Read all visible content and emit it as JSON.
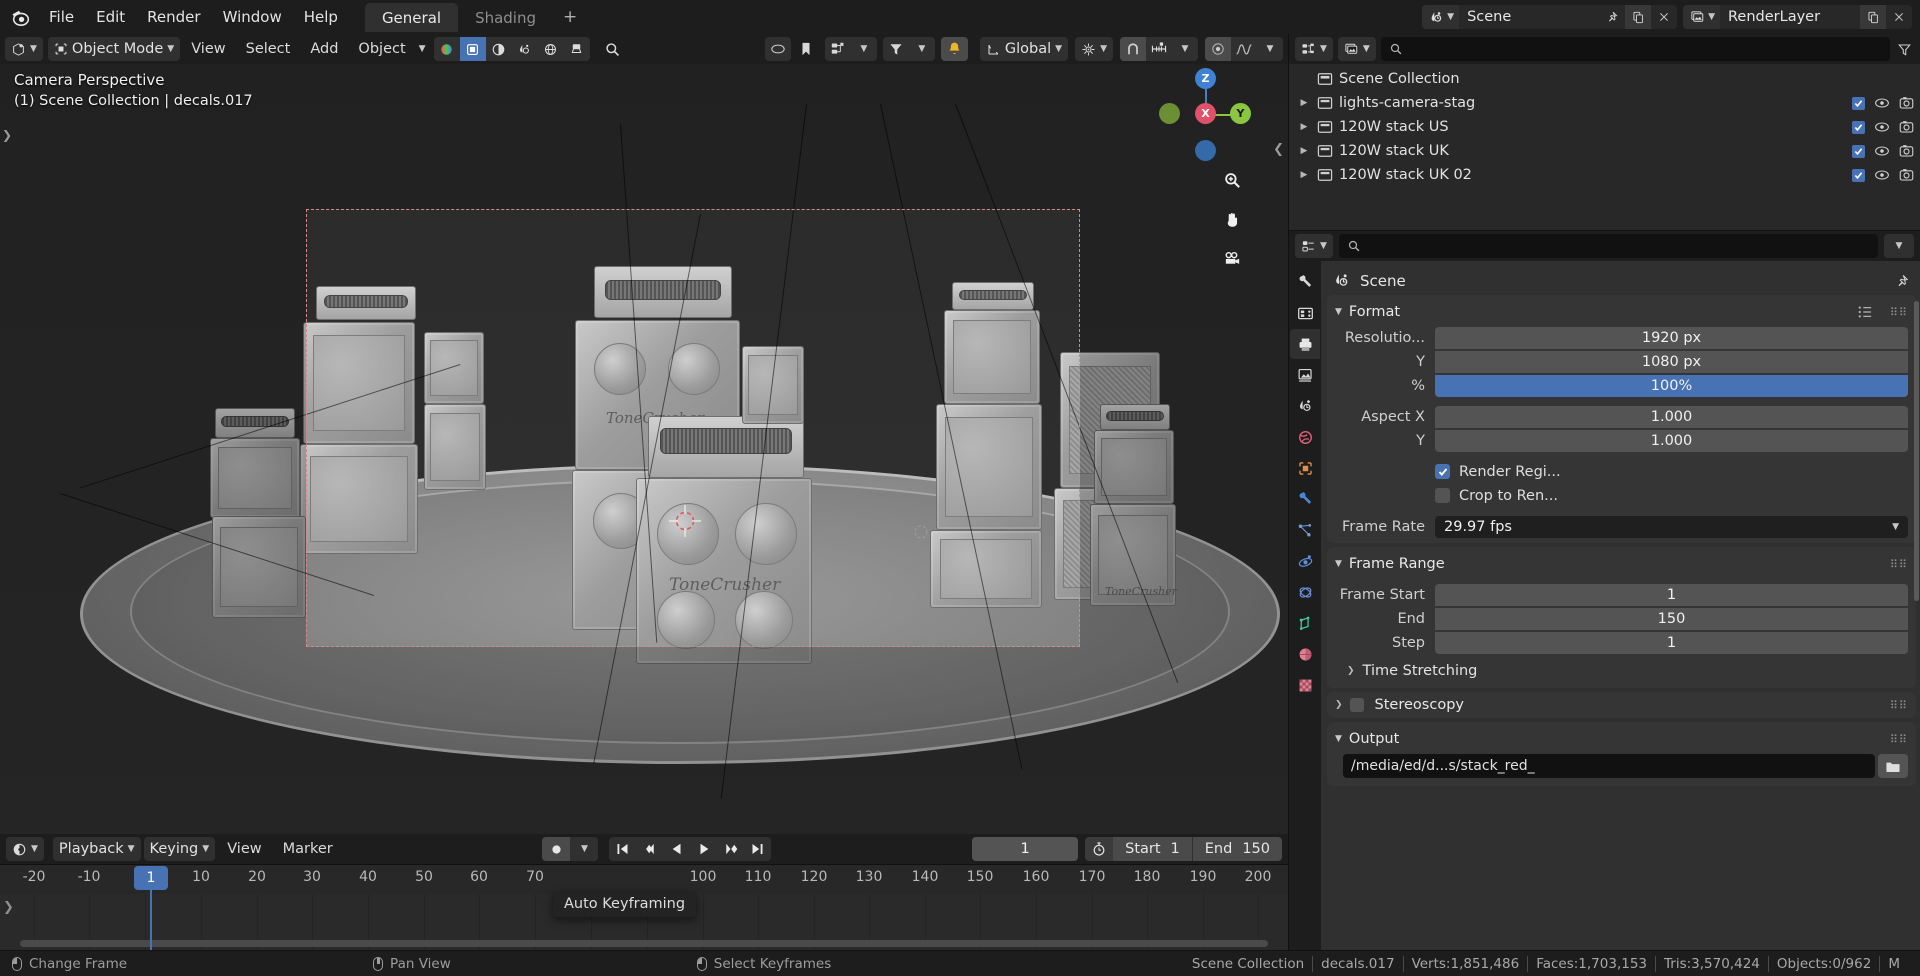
{
  "topbar": {
    "logo_icon": "blender-logo-icon",
    "menus": [
      "File",
      "Edit",
      "Render",
      "Window",
      "Help"
    ],
    "workspace_tabs": [
      {
        "label": "General",
        "active": true
      },
      {
        "label": "Shading",
        "active": false
      }
    ],
    "add_workspace_label": "+",
    "scene_block": {
      "icon": "scene-icon",
      "name": "Scene",
      "pin_icon": "pin-icon",
      "new_icon": "duplicate-icon",
      "close_icon": "x-icon"
    },
    "viewlayer_block": {
      "icon": "render-layers-icon",
      "name": "RenderLayer",
      "new_icon": "duplicate-icon",
      "close_icon": "x-icon"
    }
  },
  "viewport_header": {
    "editor_type_icon": "editor-type-3dview-icon",
    "mode_icon": "object-mode-icon",
    "mode_label": "Object Mode",
    "menus": [
      "View",
      "Select",
      "Add",
      "Object"
    ],
    "object_dropdown_chevron": "chevron-down-icon",
    "shading_modes": [
      "wireframe-icon",
      "solid-icon",
      "material-preview-icon",
      "rendered-icon"
    ],
    "overlay_icons": [
      "gizmo-icon",
      "overlays-icon",
      "xray-icon",
      "shading-globe-icon",
      "shading-brush-icon"
    ],
    "search_icon": "search-icon",
    "right_icons": [
      "visibility-icon",
      "marker-icon",
      "collection-visibility-icon",
      "filter-icon",
      "notification-bell-icon"
    ],
    "transform_orientation": {
      "icon": "orientation-icon",
      "label": "Global",
      "chevron": "chevron-down-icon"
    },
    "pivot_icon": "pivot-point-icon",
    "snap_magnet_icon": "snap-magnet-icon",
    "snap_to_icon": "snap-increment-icon",
    "proportional_icon": "proportional-edit-icon",
    "falloff_icon": "proportional-falloff-icon"
  },
  "viewport": {
    "line1": "Camera Perspective",
    "line2": "(1) Scene Collection | decals.017",
    "gizmo": {
      "z": "Z",
      "x": "X",
      "y": "Y"
    },
    "nav_buttons": [
      "zoom-icon",
      "pan-hand-icon",
      "camera-view-icon"
    ],
    "collapse_icon": "chevron-left-icon",
    "amp_logo_text": "ToneCrusher"
  },
  "timeline": {
    "editor_icon": "timeline-editor-icon",
    "menus": [
      "Playback",
      "Keying",
      "View",
      "Marker"
    ],
    "record_icon": "record-keying-icon",
    "transport": [
      "jump-start-icon",
      "prev-keyframe-icon",
      "play-reverse-icon",
      "play-icon",
      "next-keyframe-icon",
      "jump-end-icon"
    ],
    "current_frame": "1",
    "stopwatch_icon": "use-preview-range-icon",
    "start_label": "Start",
    "start_value": "1",
    "end_label": "End",
    "end_value": "150",
    "ticks": [
      "-20",
      "-10",
      "1",
      "10",
      "20",
      "30",
      "40",
      "50",
      "60",
      "70",
      "100",
      "110",
      "120",
      "130",
      "140",
      "150",
      "160",
      "170",
      "180",
      "190",
      "200"
    ],
    "playhead_label": "1",
    "tooltip": "Auto Keyframing",
    "side_arrow_icon": "chevron-right-icon"
  },
  "outliner": {
    "display_mode_icon": "outliner-display-mode-icon",
    "filter_id_icon": "outliner-id-filter-icon",
    "search_icon": "search-icon",
    "filter_icon": "filter-icon",
    "root": {
      "icon": "scene-collection-icon",
      "label": "Scene Collection"
    },
    "rows": [
      {
        "label": "lights-camera-stag",
        "icon": "collection-icon",
        "expand": "triangle-right-icon",
        "checkbox": true,
        "eye_icon": "eye-icon",
        "camera_icon": "camera-render-icon"
      },
      {
        "label": "120W stack US",
        "icon": "collection-icon",
        "expand": "triangle-right-icon",
        "checkbox": true,
        "eye_icon": "eye-icon",
        "camera_icon": "camera-render-icon"
      },
      {
        "label": "120W stack UK",
        "icon": "collection-icon",
        "expand": "triangle-right-icon",
        "checkbox": true,
        "eye_icon": "eye-icon",
        "camera_icon": "camera-render-icon"
      },
      {
        "label": "120W stack UK 02",
        "icon": "collection-icon",
        "expand": "triangle-right-icon",
        "checkbox": true,
        "eye_icon": "eye-icon",
        "camera_icon": "camera-render-icon"
      }
    ]
  },
  "properties": {
    "editor_icon": "properties-editor-icon",
    "search_icon": "search-icon",
    "options_chevron": "chevron-down-icon",
    "id_icon": "scene-properties-icon",
    "id_name": "Scene",
    "pin_icon": "pin-icon",
    "tabs": [
      {
        "name": "tool-tab",
        "icon": "wrench-screwdriver-icon",
        "active": false
      },
      {
        "name": "render-tab",
        "icon": "camera-back-icon",
        "active": false
      },
      {
        "name": "output-tab",
        "icon": "printer-icon",
        "active": true
      },
      {
        "name": "view-layer-tab",
        "icon": "images-icon",
        "active": false
      },
      {
        "name": "scene-tab",
        "icon": "scene-cone-icon",
        "active": false
      },
      {
        "name": "world-tab",
        "icon": "world-globe-icon",
        "active": false
      },
      {
        "name": "object-tab",
        "icon": "object-square-icon",
        "active": false
      },
      {
        "name": "modifier-tab",
        "icon": "wrench-icon",
        "active": false
      },
      {
        "name": "particles-tab",
        "icon": "particles-icon",
        "active": false
      },
      {
        "name": "physics-tab",
        "icon": "physics-orbit-icon",
        "active": false
      },
      {
        "name": "constraints-tab",
        "icon": "constraint-icon",
        "active": false
      },
      {
        "name": "data-tab",
        "icon": "mesh-data-icon",
        "active": false
      },
      {
        "name": "material-tab",
        "icon": "material-sphere-icon",
        "active": false
      },
      {
        "name": "texture-tab",
        "icon": "texture-checker-icon",
        "active": false
      }
    ],
    "format_panel": {
      "title": "Format",
      "preset_icon": "preset-list-icon",
      "grip_icon": "grip-dots-icon",
      "rows": [
        {
          "label": "Resolutio...",
          "value": "1920 px",
          "highlight": false
        },
        {
          "label": "Y",
          "value": "1080 px",
          "highlight": false
        },
        {
          "label": "%",
          "value": "100%",
          "highlight": true
        }
      ],
      "aspect": [
        {
          "label": "Aspect X",
          "value": "1.000"
        },
        {
          "label": "Y",
          "value": "1.000"
        }
      ],
      "checks": [
        {
          "label": "Render Regi...",
          "checked": true
        },
        {
          "label": "Crop to Ren...",
          "checked": false
        }
      ],
      "frame_rate_label": "Frame Rate",
      "frame_rate_value": "29.97 fps",
      "frame_rate_chevron": "chevron-down-icon"
    },
    "frame_range_panel": {
      "title": "Frame Range",
      "grip_icon": "grip-dots-icon",
      "rows": [
        {
          "label": "Frame Start",
          "value": "1"
        },
        {
          "label": "End",
          "value": "150"
        },
        {
          "label": "Step",
          "value": "1"
        }
      ]
    },
    "time_stretching": {
      "title": "Time Stretching",
      "expand_icon": "triangle-right-icon"
    },
    "stereoscopy": {
      "title": "Stereoscopy",
      "expand_icon": "triangle-right-icon",
      "checked": false,
      "grip_icon": "grip-dots-icon"
    },
    "output_panel": {
      "title": "Output",
      "grip_icon": "grip-dots-icon",
      "path": "/media/ed/d...s/stack_red_",
      "folder_icon": "folder-icon"
    }
  },
  "statusbar": {
    "hints": [
      {
        "icon": "mouse-left-icon",
        "label": "Change Frame"
      },
      {
        "icon": "mouse-middle-icon",
        "label": "Pan View"
      },
      {
        "icon": "mouse-left-icon",
        "label": "Select Keyframes"
      }
    ],
    "stats": [
      "Scene Collection",
      "decals.017",
      "Verts:1,851,486",
      "Faces:1,703,153",
      "Tris:3,570,424",
      "Objects:0/962",
      "M"
    ]
  },
  "colors": {
    "accent_blue": "#4772b3",
    "panel_bg": "#303030",
    "header_bg": "#1d1d1d",
    "field_bg": "#545454",
    "camera_border": "#d08a8a",
    "axis_x": "#e2506a",
    "axis_y": "#8cc640",
    "axis_z": "#3f82d4"
  }
}
